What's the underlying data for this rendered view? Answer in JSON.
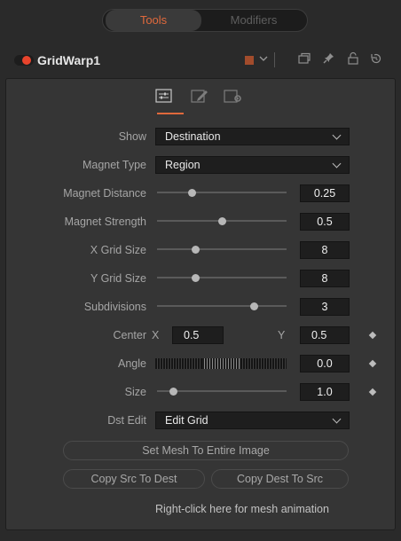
{
  "tabs": [
    {
      "label": "Tools",
      "active": true
    },
    {
      "label": "Modifiers",
      "active": false
    }
  ],
  "header": {
    "tool_name": "GridWarp1",
    "color_swatch": "#a24c2c",
    "icons": [
      "toggle-switch-icon",
      "color-dropdown-icon",
      "window-icon",
      "pin-icon",
      "lock-icon",
      "reset-icon"
    ]
  },
  "panel_tabs": [
    {
      "icon": "controls-icon",
      "active": true
    },
    {
      "icon": "settings-edit-icon",
      "active": false
    },
    {
      "icon": "settings-gear-icon",
      "active": false
    }
  ],
  "fields": {
    "show": {
      "label": "Show",
      "value": "Destination"
    },
    "magnet_type": {
      "label": "Magnet Type",
      "value": "Region"
    },
    "magnet_distance": {
      "label": "Magnet Distance",
      "value": "0.25",
      "level": 0.27
    },
    "magnet_strength": {
      "label": "Magnet Strength",
      "value": "0.5",
      "level": 0.5
    },
    "x_grid_size": {
      "label": "X Grid Size",
      "value": "8",
      "level": 0.3
    },
    "y_grid_size": {
      "label": "Y Grid Size",
      "value": "8",
      "level": 0.3
    },
    "subdivisions": {
      "label": "Subdivisions",
      "value": "3",
      "level": 0.75
    },
    "center": {
      "label": "Center",
      "x_label": "X",
      "x_value": "0.5",
      "y_label": "Y",
      "y_value": "0.5"
    },
    "angle": {
      "label": "Angle",
      "value": "0.0"
    },
    "size": {
      "label": "Size",
      "value": "1.0",
      "level": 0.13
    },
    "dst_edit": {
      "label": "Dst Edit",
      "value": "Edit Grid"
    }
  },
  "buttons": {
    "set_mesh": "Set Mesh To Entire Image",
    "copy_src_to_dest": "Copy Src To Dest",
    "copy_dest_to_src": "Copy Dest To Src"
  },
  "hint": "Right-click here for mesh animation",
  "colors": {
    "accent": "#e0693c",
    "toggle_on": "#e8442c"
  }
}
